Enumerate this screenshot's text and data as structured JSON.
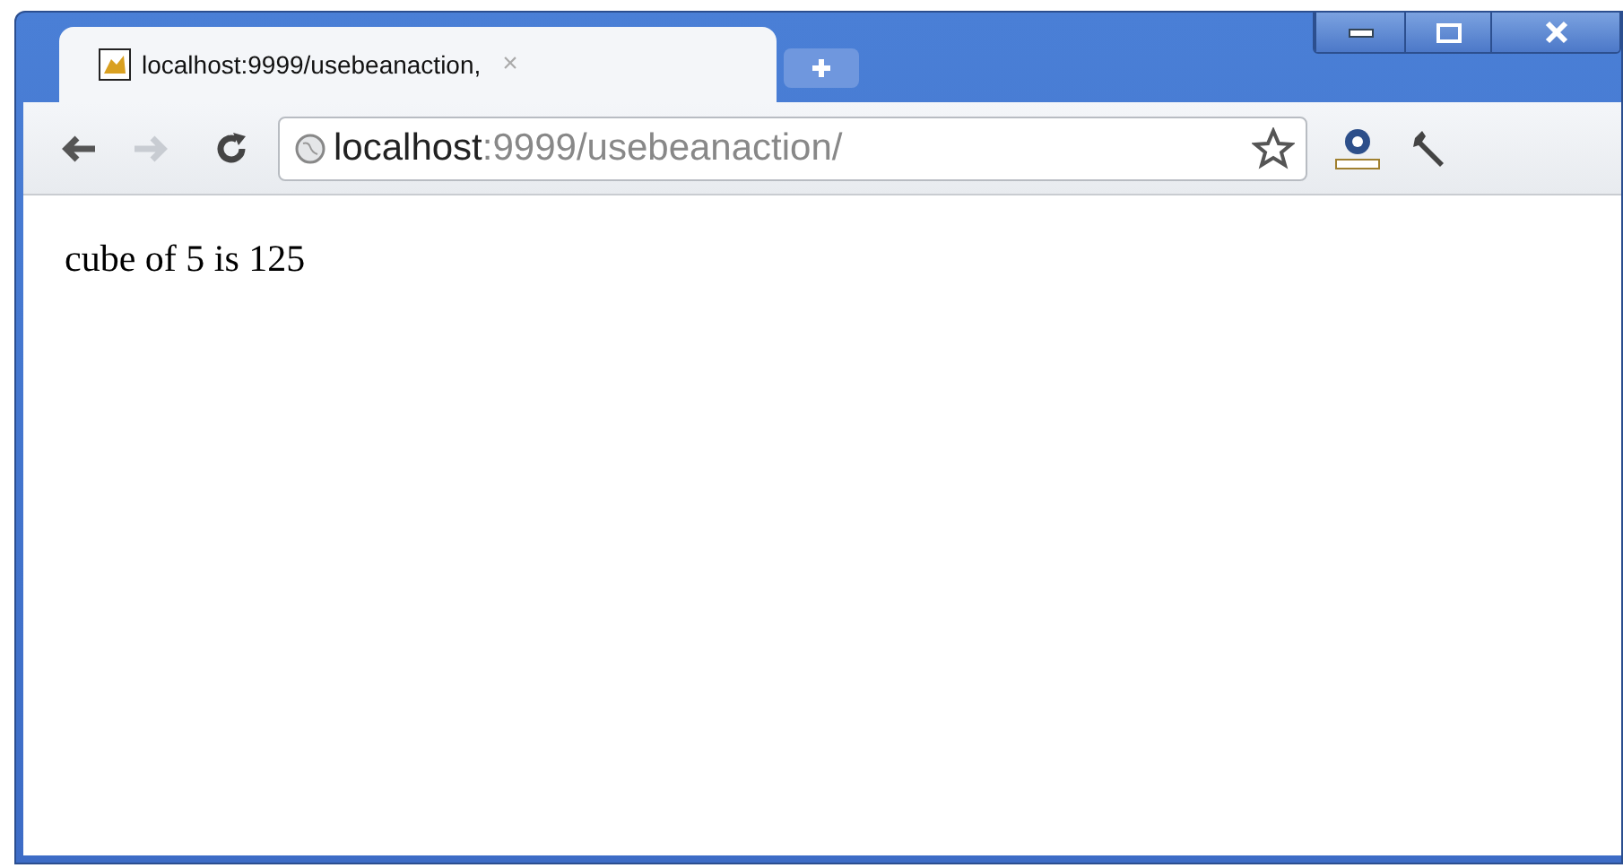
{
  "tabs": [
    {
      "title": "localhost:9999/usebeanaction,",
      "close": "×",
      "selected": true
    }
  ],
  "address": {
    "host": "localhost",
    "path": ":9999/usebeanaction/"
  },
  "nav": {
    "back_disabled": false,
    "forward_disabled": true
  },
  "page": {
    "text": "cube of 5 is 125"
  }
}
